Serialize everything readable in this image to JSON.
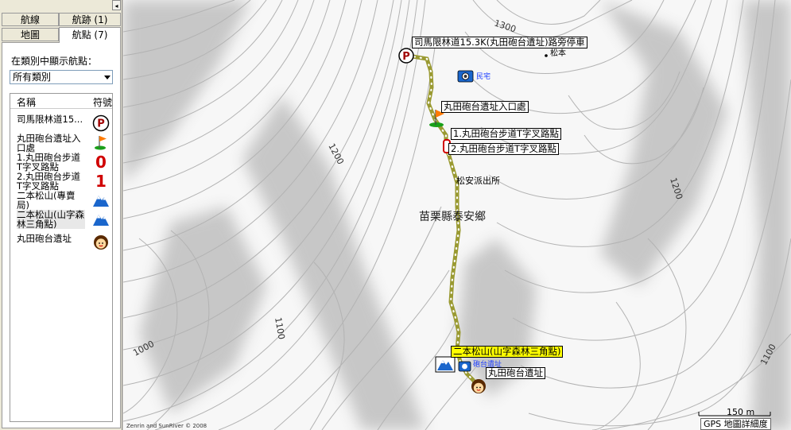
{
  "sidebar": {
    "collapse_glyph": "◂",
    "tabs": {
      "routes": "航線",
      "tracks": "航跡 (1)",
      "maps": "地圖",
      "waypoints": "航點 (7)"
    },
    "filter_label": "在類別中顯示航點：",
    "category_select": "所有類別",
    "list_headers": {
      "name": "名稱",
      "symbol": "符號"
    },
    "waypoints": [
      {
        "name": "司馬限林道15...",
        "symbol": "parking-icon"
      },
      {
        "name": "丸田砲台遺址入口處",
        "symbol": "flag-icon"
      },
      {
        "name": "1.丸田砲台步道T字叉路點",
        "symbol": "number-0-icon"
      },
      {
        "name": "2.丸田砲台步道T字叉路點",
        "symbol": "number-1-icon"
      },
      {
        "name": "二本松山(專賣局)",
        "symbol": "summit-icon"
      },
      {
        "name": "二本松山(山字森林三角點)",
        "symbol": "summit-icon"
      },
      {
        "name": "丸田砲台遺址",
        "symbol": "face-icon"
      }
    ]
  },
  "map": {
    "contours": [
      "1300",
      "1200",
      "1200",
      "1100",
      "1000",
      "1100"
    ],
    "place_labels": {
      "elev": "松本",
      "police": "松安派出所",
      "township": "苗栗縣泰安鄉",
      "cam_label": "民宅",
      "cam_label2": "砲台遺址"
    },
    "waypoint_labels": {
      "parking": "司馬限林道15.3K(丸田砲台遺址)路旁停車",
      "entrance": "丸田砲台遺址入口處",
      "junction1": "1.丸田砲台步道T字叉路點",
      "junction2": "2.丸田砲台步道T字叉路點",
      "summit": "二本松山(山字森林三角點)",
      "ruins": "丸田砲台遺址"
    },
    "copyright": "Zenrin and SunRiver © 2008",
    "scale_label": "150 m",
    "detail_label": "GPS 地圖詳細度"
  },
  "colors": {
    "track": "#9a9a32",
    "track_dots": "#ffffff",
    "contour": "#b8b8b8",
    "hill_shade": "#8a8a8a"
  }
}
